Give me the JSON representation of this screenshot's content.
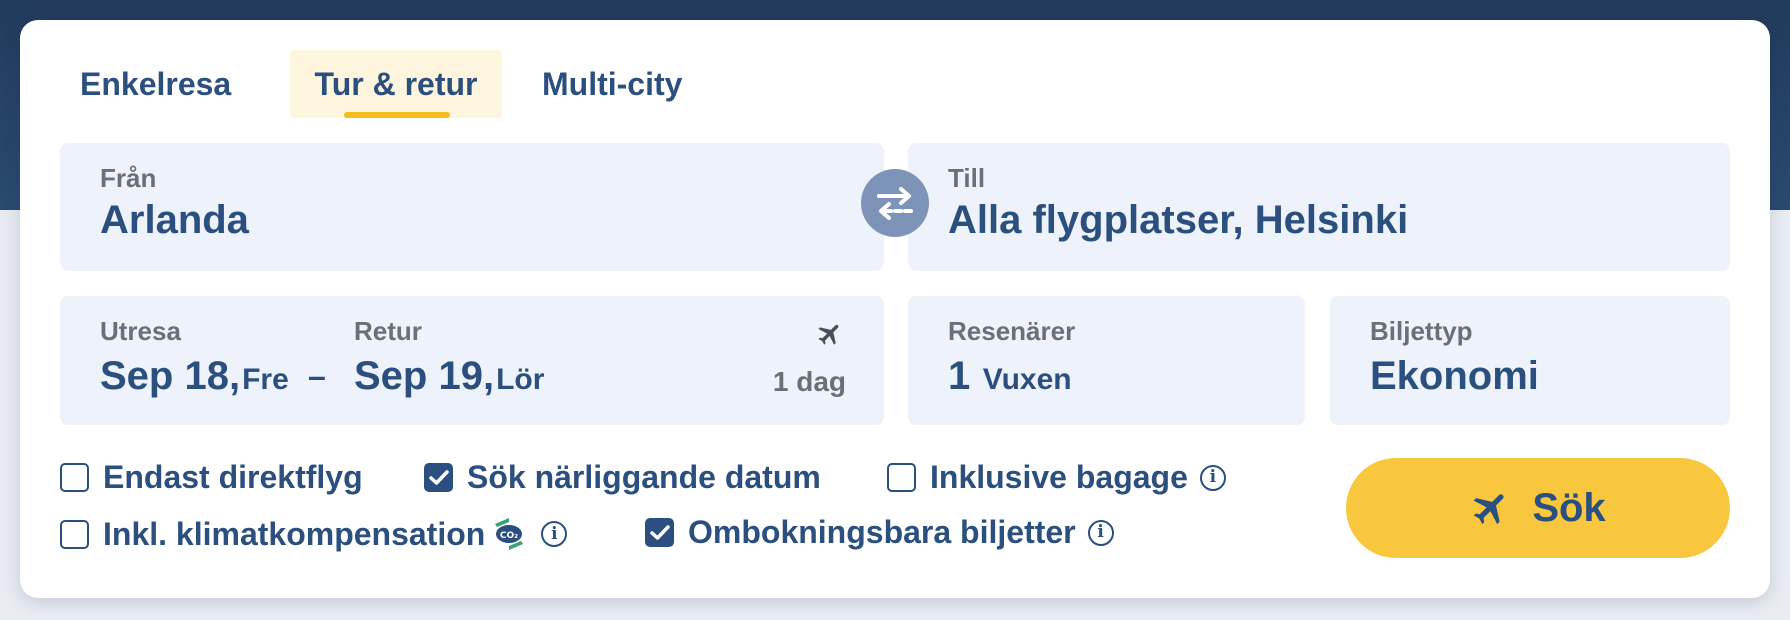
{
  "tabs": [
    {
      "label": "Enkelresa",
      "selected": false
    },
    {
      "label": "Tur & retur",
      "selected": true
    },
    {
      "label": "Multi-city",
      "selected": false
    }
  ],
  "from": {
    "label": "Från",
    "value": "Arlanda"
  },
  "to": {
    "label": "Till",
    "value": "Alla flygplatser, Helsinki"
  },
  "dates": {
    "outbound_label": "Utresa",
    "outbound_date": "Sep 18,",
    "outbound_day": "Fre",
    "separator": "–",
    "return_label": "Retur",
    "return_date": "Sep 19,",
    "return_day": "Lör",
    "duration": "1 dag"
  },
  "travellers": {
    "label": "Resenärer",
    "count": "1",
    "type": "Vuxen"
  },
  "ticket": {
    "label": "Biljettyp",
    "value": "Ekonomi"
  },
  "options": {
    "direct": {
      "label": "Endast direktflyg",
      "checked": false
    },
    "nearby": {
      "label": "Sök närliggande datum",
      "checked": true
    },
    "baggage": {
      "label": "Inklusive bagage",
      "checked": false
    },
    "climate": {
      "label": "Inkl. klimatkompensation",
      "checked": false,
      "badge": "CO₂"
    },
    "rebookable": {
      "label": "Ombokningsbara biljetter",
      "checked": true
    }
  },
  "search_button": {
    "label": "Sök"
  },
  "colors": {
    "primary": "#2b4f7e",
    "accent": "#f8c73e",
    "field_bg": "#eef2fa",
    "swap_bg": "#7e93b8",
    "header_bg": "#223b5c"
  }
}
